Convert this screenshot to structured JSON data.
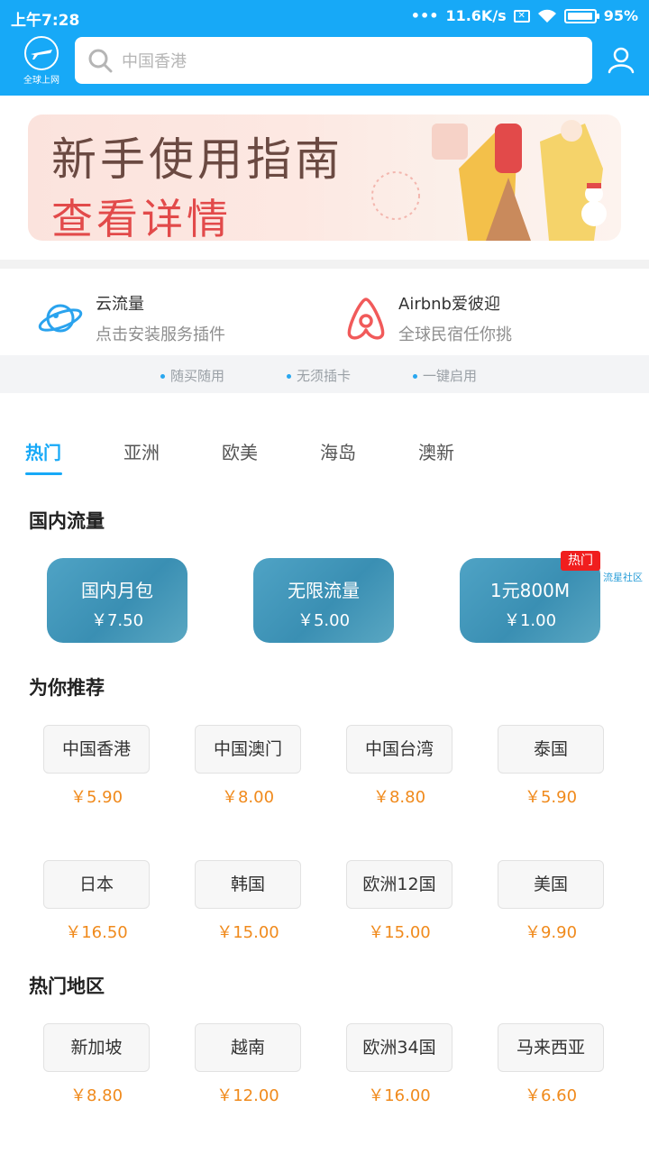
{
  "status_bar": {
    "time": "上午7:28",
    "network_speed": "11.6K/s",
    "battery": "95%",
    "battery_level": 0.95
  },
  "header": {
    "logo_label": "全球上网",
    "search_placeholder": "中国香港"
  },
  "banner": {
    "line1": "新手使用指南",
    "line2": "查看详情"
  },
  "services": [
    {
      "title": "云流量",
      "subtitle": "点击安装服务插件",
      "icon": "planet-icon"
    },
    {
      "title": "Airbnb爱彼迎",
      "subtitle": "全球民宿任你挑",
      "icon": "airbnb-logo-icon"
    }
  ],
  "features": [
    "随买随用",
    "无须插卡",
    "一键启用"
  ],
  "tabs": [
    "热门",
    "亚洲",
    "欧美",
    "海岛",
    "澳新"
  ],
  "active_tab": "热门",
  "domestic": {
    "title": "国内流量",
    "cards": [
      {
        "name": "国内月包",
        "price": "￥7.50"
      },
      {
        "name": "无限流量",
        "price": "￥5.00"
      },
      {
        "name": "1元800M",
        "price": "￥1.00",
        "badge": "热门"
      }
    ],
    "community_label": "流星社区"
  },
  "recommended": {
    "title": "为你推荐",
    "items": [
      {
        "name": "中国香港",
        "price": "￥5.90"
      },
      {
        "name": "中国澳门",
        "price": "￥8.00"
      },
      {
        "name": "中国台湾",
        "price": "￥8.80"
      },
      {
        "name": "泰国",
        "price": "￥5.90"
      },
      {
        "name": "日本",
        "price": "￥16.50"
      },
      {
        "name": "韩国",
        "price": "￥15.00"
      },
      {
        "name": "欧洲12国",
        "price": "￥15.00"
      },
      {
        "name": "美国",
        "price": "￥9.90"
      }
    ]
  },
  "hot_regions": {
    "title": "热门地区",
    "items": [
      {
        "name": "新加坡",
        "price": "￥8.80"
      },
      {
        "name": "越南",
        "price": "￥12.00"
      },
      {
        "name": "欧洲34国",
        "price": "￥16.00"
      },
      {
        "name": "马来西亚",
        "price": "￥6.60"
      }
    ]
  }
}
